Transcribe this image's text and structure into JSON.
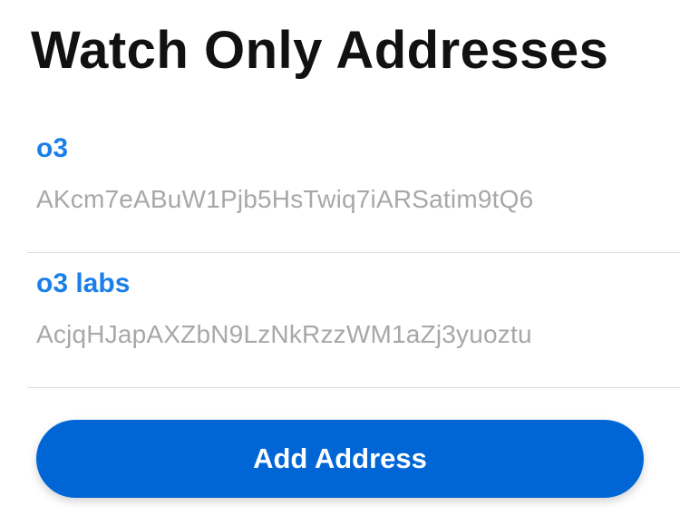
{
  "page": {
    "title": "Watch Only Addresses"
  },
  "addresses": [
    {
      "nickname": "o3",
      "address": "AKcm7eABuW1Pjb5HsTwiq7iARSatim9tQ6"
    },
    {
      "nickname": "o3 labs",
      "address": "AcjqHJapAXZbN9LzNkRzzWM1aZj3yuoztu"
    }
  ],
  "actions": {
    "add_label": "Add Address"
  },
  "colors": {
    "accent": "#1a7fe8",
    "button": "#0066d6",
    "secondary_text": "#a8a8a8"
  }
}
